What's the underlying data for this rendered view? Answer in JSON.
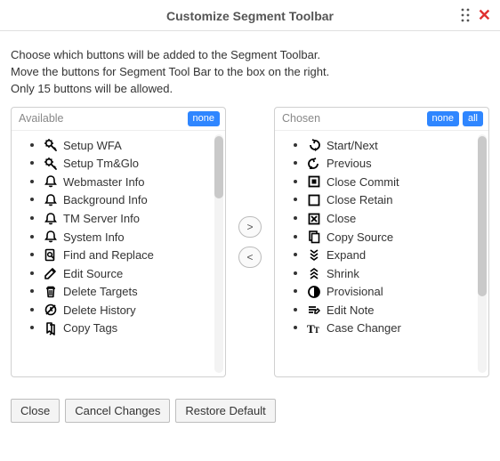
{
  "header": {
    "title": "Customize Segment Toolbar"
  },
  "instructions": {
    "line1": "Choose which buttons will be added to the Segment Toolbar.",
    "line2": "Move the buttons for Segment Tool Bar to the box on the right.",
    "line3": "Only 15 buttons will be allowed."
  },
  "panels": {
    "left": {
      "label": "Available",
      "pills": {
        "none": "none"
      },
      "items": [
        {
          "icon": "gear-wand",
          "label": "Setup WFA"
        },
        {
          "icon": "gear-wand",
          "label": "Setup Tm&Glo"
        },
        {
          "icon": "bell",
          "label": "Webmaster Info"
        },
        {
          "icon": "bell",
          "label": "Background Info"
        },
        {
          "icon": "bell",
          "label": "TM Server Info"
        },
        {
          "icon": "bell",
          "label": "System Info"
        },
        {
          "icon": "doc-search",
          "label": "Find and Replace"
        },
        {
          "icon": "edit-pencil",
          "label": "Edit Source"
        },
        {
          "icon": "trash",
          "label": "Delete Targets"
        },
        {
          "icon": "no-history",
          "label": "Delete History"
        },
        {
          "icon": "bookmark-copy",
          "label": "Copy Tags"
        }
      ]
    },
    "right": {
      "label": "Chosen",
      "pills": {
        "none": "none",
        "all": "all"
      },
      "items": [
        {
          "icon": "start-next",
          "label": "Start/Next"
        },
        {
          "icon": "previous",
          "label": "Previous"
        },
        {
          "icon": "square-filled",
          "label": "Close Commit"
        },
        {
          "icon": "square-empty",
          "label": "Close Retain"
        },
        {
          "icon": "square-x",
          "label": "Close"
        },
        {
          "icon": "copy",
          "label": "Copy Source"
        },
        {
          "icon": "chevrons-down",
          "label": "Expand"
        },
        {
          "icon": "chevrons-up",
          "label": "Shrink"
        },
        {
          "icon": "half-circle",
          "label": "Provisional"
        },
        {
          "icon": "note-edit",
          "label": "Edit Note"
        },
        {
          "icon": "case-changer",
          "label": "Case Changer"
        }
      ]
    }
  },
  "transfer": {
    "right": ">",
    "left": "<"
  },
  "footer": {
    "close": "Close",
    "cancel": "Cancel Changes",
    "restore": "Restore Default"
  }
}
